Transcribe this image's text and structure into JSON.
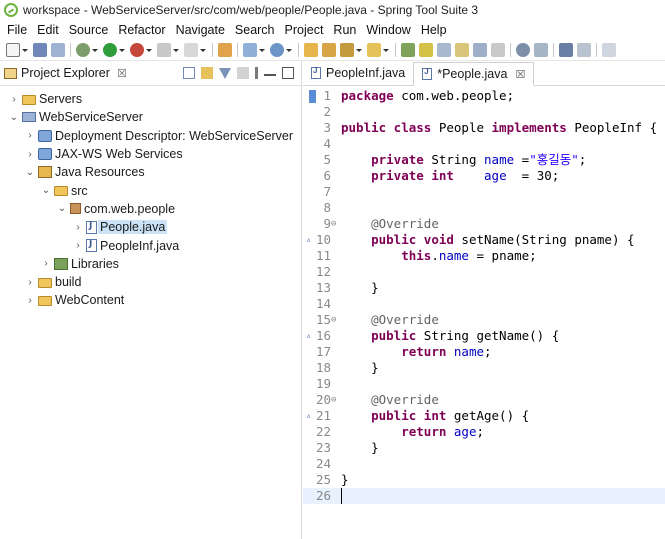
{
  "window": {
    "title": "workspace - WebServiceServer/src/com/web/people/People.java - Spring Tool Suite 3"
  },
  "menu": [
    "File",
    "Edit",
    "Source",
    "Refactor",
    "Navigate",
    "Search",
    "Project",
    "Run",
    "Window",
    "Help"
  ],
  "explorer": {
    "title": "Project Explorer",
    "close": "☒",
    "tree": [
      {
        "label": "Servers",
        "chevron": "›",
        "icon": "folder",
        "indent": 0
      },
      {
        "label": "WebServiceServer",
        "chevron": "⌄",
        "icon": "project",
        "indent": 0
      },
      {
        "label": "Deployment Descriptor: WebServiceServer",
        "chevron": "›",
        "icon": "web",
        "indent": 1
      },
      {
        "label": "JAX-WS Web Services",
        "chevron": "›",
        "icon": "web",
        "indent": 1
      },
      {
        "label": "Java Resources",
        "chevron": "⌄",
        "icon": "jar",
        "indent": 1
      },
      {
        "label": "src",
        "chevron": "⌄",
        "icon": "folder",
        "indent": 2
      },
      {
        "label": "com.web.people",
        "chevron": "⌄",
        "icon": "pkg",
        "indent": 3
      },
      {
        "label": "People.java",
        "chevron": "›",
        "icon": "javafile",
        "indent": 4,
        "selected": true
      },
      {
        "label": "PeopleInf.java",
        "chevron": "›",
        "icon": "javafile",
        "indent": 4
      },
      {
        "label": "Libraries",
        "chevron": "›",
        "icon": "lib",
        "indent": 2
      },
      {
        "label": "build",
        "chevron": "›",
        "icon": "folder",
        "indent": 1
      },
      {
        "label": "WebContent",
        "chevron": "›",
        "icon": "folder",
        "indent": 1
      }
    ]
  },
  "editor": {
    "tabs": [
      {
        "label": "PeopleInf.java",
        "active": false
      },
      {
        "label": "*People.java",
        "active": true,
        "close": "☒"
      }
    ],
    "lines": [
      {
        "n": "1",
        "html": "<span class=\"kw\">package</span> com.web.people;"
      },
      {
        "n": "2",
        "html": ""
      },
      {
        "n": "3",
        "html": "<span class=\"kw\">public class</span> People <span class=\"kw\">implements</span> PeopleInf {"
      },
      {
        "n": "4",
        "html": ""
      },
      {
        "n": "5",
        "html": "    <span class=\"kw\">private</span> String <span class=\"fld\">name</span> =<span class=\"str\">\"홍길동\"</span>;"
      },
      {
        "n": "6",
        "html": "    <span class=\"kw\">private int</span>    <span class=\"fld\">age</span>  = 30;"
      },
      {
        "n": "7",
        "html": ""
      },
      {
        "n": "8",
        "html": ""
      },
      {
        "n": "9",
        "fold": "⊖",
        "html": "    <span class=\"ann\">@Override</span>"
      },
      {
        "n": "10",
        "ovr": "▵",
        "html": "    <span class=\"kw\">public void</span> setName(String pname) {"
      },
      {
        "n": "11",
        "html": "        <span class=\"kw\">this</span>.<span class=\"fld\">name</span> = pname;"
      },
      {
        "n": "12",
        "html": ""
      },
      {
        "n": "13",
        "html": "    }"
      },
      {
        "n": "14",
        "html": ""
      },
      {
        "n": "15",
        "fold": "⊖",
        "html": "    <span class=\"ann\">@Override</span>"
      },
      {
        "n": "16",
        "ovr": "▵",
        "html": "    <span class=\"kw\">public</span> String getName() {"
      },
      {
        "n": "17",
        "html": "        <span class=\"kw\">return</span> <span class=\"fld\">name</span>;"
      },
      {
        "n": "18",
        "html": "    }"
      },
      {
        "n": "19",
        "html": ""
      },
      {
        "n": "20",
        "fold": "⊖",
        "html": "    <span class=\"ann\">@Override</span>"
      },
      {
        "n": "21",
        "ovr": "▵",
        "html": "    <span class=\"kw\">public int</span> getAge() {"
      },
      {
        "n": "22",
        "html": "        <span class=\"kw\">return</span> <span class=\"fld\">age</span>;"
      },
      {
        "n": "23",
        "html": "    }"
      },
      {
        "n": "24",
        "html": ""
      },
      {
        "n": "25",
        "html": "}"
      },
      {
        "n": "26",
        "html": "",
        "current": true
      }
    ]
  }
}
